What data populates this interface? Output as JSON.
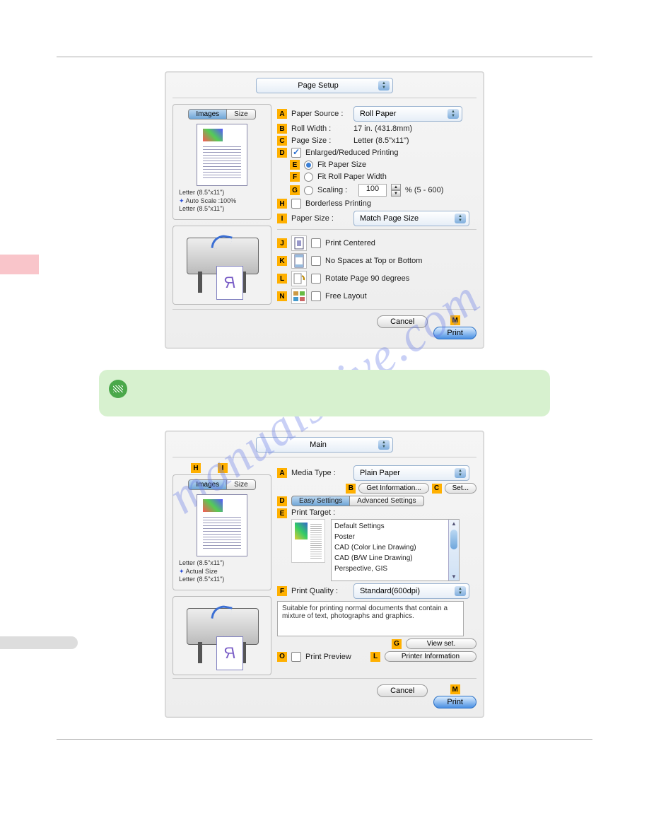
{
  "watermark": "manualshive.com",
  "panel1": {
    "selector": "Page Setup",
    "tabs": {
      "images": "Images",
      "size": "Size"
    },
    "caption1": "Letter (8.5\"x11\")",
    "caption2": "Auto Scale :100%",
    "caption3": "Letter (8.5\"x11\")",
    "A_label": "Paper Source :",
    "A_value": "Roll Paper",
    "B_label": "Roll Width :",
    "B_value": "17 in. (431.8mm)",
    "C_label": "Page Size :",
    "C_value": "Letter (8.5\"x11\")",
    "D_label": "Enlarged/Reduced Printing",
    "E_label": "Fit Paper Size",
    "F_label": "Fit Roll Paper Width",
    "G_label": "Scaling :",
    "G_value": "100",
    "G_suffix": "% (5 - 600)",
    "H_label": "Borderless Printing",
    "I_label": "Paper Size :",
    "I_value": "Match Page Size",
    "J_label": "Print Centered",
    "K_label": "No Spaces at Top or Bottom",
    "L_label": "Rotate Page 90 degrees",
    "N_label": "Free Layout",
    "cancel": "Cancel",
    "print": "Print",
    "M": "M"
  },
  "panel2": {
    "selector": "Main",
    "H": "H",
    "I": "I",
    "tabs": {
      "images": "Images",
      "size": "Size"
    },
    "caption1": "Letter (8.5\"x11\")",
    "caption2": "Actual Size",
    "caption3": "Letter (8.5\"x11\")",
    "A_label": "Media Type :",
    "A_value": "Plain Paper",
    "B_btn": "Get Information...",
    "C_btn": "Set...",
    "seg_easy": "Easy Settings",
    "seg_adv": "Advanced Settings",
    "E_label": "Print Target :",
    "targets": [
      "Default Settings",
      "Poster",
      "CAD (Color Line Drawing)",
      "CAD (B/W Line Drawing)",
      "Perspective, GIS"
    ],
    "F_label": "Print Quality :",
    "F_value": "Standard(600dpi)",
    "desc": "Suitable for printing normal documents that contain a mixture of text, photographs and graphics.",
    "G_btn": "View set.",
    "O_label": "Print Preview",
    "L_btn": "Printer Information",
    "cancel": "Cancel",
    "print": "Print",
    "M": "M"
  },
  "letters": {
    "A": "A",
    "B": "B",
    "C": "C",
    "D": "D",
    "E": "E",
    "F": "F",
    "G": "G",
    "H": "H",
    "I": "I",
    "J": "J",
    "K": "K",
    "L": "L",
    "M": "M",
    "N": "N",
    "O": "O"
  }
}
